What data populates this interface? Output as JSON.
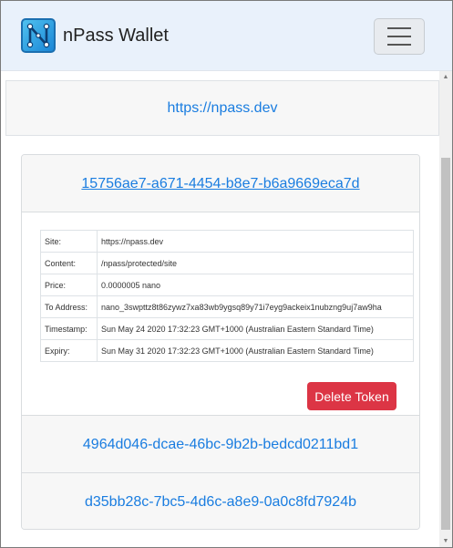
{
  "navbar": {
    "brand": "nPass Wallet",
    "logo_icon": "npass-logo-icon",
    "menu_icon": "hamburger-menu-icon"
  },
  "site": {
    "url": "https://npass.dev"
  },
  "tokens": [
    {
      "id": "15756ae7-a671-4454-b8e7-b6a9669eca7d",
      "expanded": true,
      "details": [
        {
          "key": "Site:",
          "value": "https://npass.dev"
        },
        {
          "key": "Content:",
          "value": "/npass/protected/site"
        },
        {
          "key": "Price:",
          "value": "0.0000005 nano"
        },
        {
          "key": "To Address:",
          "value": "nano_3swpttz8t86zywz7xa83wb9ygsq89y71i7eyg9ackeix1nubzng9uj7aw9ha"
        },
        {
          "key": "Timestamp:",
          "value": "Sun May 24 2020 17:32:23 GMT+1000 (Australian Eastern Standard Time)"
        },
        {
          "key": "Expiry:",
          "value": "Sun May 31 2020 17:32:23 GMT+1000 (Australian Eastern Standard Time)"
        }
      ],
      "delete_label": "Delete Token"
    },
    {
      "id": "4964d046-dcae-46bc-9b2b-bedcd0211bd1",
      "expanded": false
    },
    {
      "id": "d35bb28c-7bc5-4d6c-a8e9-0a0c8fd7924b",
      "expanded": false
    }
  ],
  "colors": {
    "link": "#1a7de0",
    "danger": "#dc3545",
    "navbar_bg": "#e9f1fb"
  }
}
